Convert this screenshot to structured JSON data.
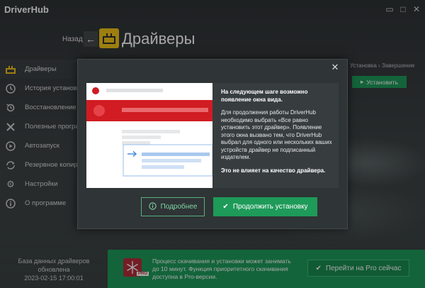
{
  "app": {
    "logo": "DriverHub",
    "window_controls": {
      "minimize": "▭",
      "maximize": "□",
      "close": "✕"
    }
  },
  "header": {
    "back_label": "Назад",
    "back_icon": "arrow-left-icon",
    "page_icon": "driver-icon",
    "title": "Драйверы"
  },
  "sidebar": {
    "items": [
      {
        "label": "Драйверы",
        "icon": "driver-icon",
        "active": true
      },
      {
        "label": "История установок",
        "icon": "clock-icon"
      },
      {
        "label": "Восстановление",
        "icon": "restore-icon"
      },
      {
        "label": "Полезные программы",
        "icon": "tools-icon"
      },
      {
        "label": "Автозапуск",
        "icon": "autostart-icon"
      },
      {
        "label": "Резервное копирование",
        "icon": "backup-icon"
      },
      {
        "label": "Настройки",
        "icon": "gear-icon"
      },
      {
        "label": "О программе",
        "icon": "info-icon"
      }
    ]
  },
  "steps": {
    "step_current": "Установка",
    "step_next": "Завершение",
    "separator": "›"
  },
  "background_install_button": "Установить",
  "db_info": {
    "line1": "База данных драйверов",
    "line2": "обновлена",
    "line3": "2023-02-15 17:00:01"
  },
  "pro": {
    "tag": "PRO",
    "text": "Процесс скачивания и установки может занимать до 10 минут. Функция приоритетного скачивания доступна в Pro-версии.",
    "button": "Перейти на Pro сейчас"
  },
  "modal": {
    "close_icon": "✕",
    "heading": "На следующем шаге возможно появление окна вида.",
    "paragraph1": "Для продолжения работы DriverHub необходимо выбрать «Все равно установить этот драйвер». Появление этого окна вызвано тем, что DriverHub выбрал для одного или нескольких ваших устройств драйвер не подписанный издателем.",
    "paragraph2": "Это не влияет на качество драйвера.",
    "more_button": "Подробнее",
    "continue_button": "Продолжить установку"
  },
  "colors": {
    "accent_green": "#1e9a59",
    "accent_yellow": "#f2c21a",
    "warning_red": "#d01c22",
    "pro_red": "#b32d3a"
  }
}
